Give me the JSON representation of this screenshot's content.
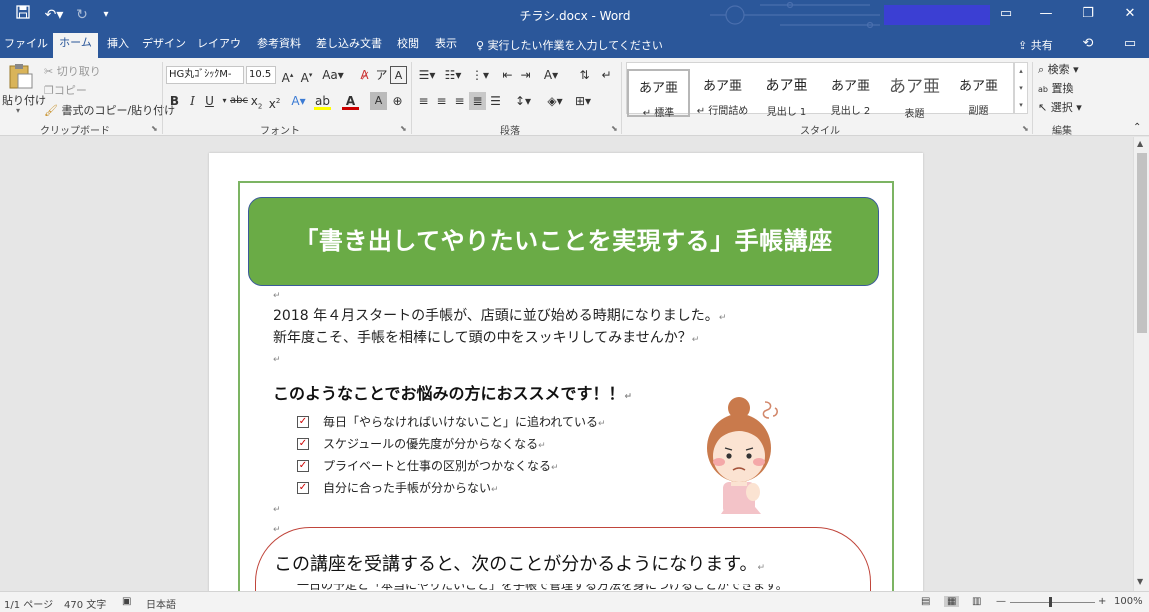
{
  "window": {
    "title": "チラシ.docx  -  Word"
  },
  "quick_access": {
    "save_icon": "save-icon",
    "undo_icon": "undo-icon",
    "redo_icon": "redo-icon",
    "customize_icon": "customize-icon"
  },
  "window_controls": {
    "ribbon_options": "▭",
    "minimize": "—",
    "maximize": "❐",
    "close": "✕"
  },
  "tabs": [
    {
      "label": "ファイル"
    },
    {
      "label": "ホーム"
    },
    {
      "label": "挿入"
    },
    {
      "label": "デザイン"
    },
    {
      "label": "レイアウト"
    },
    {
      "label": "参考資料"
    },
    {
      "label": "差し込み文書"
    },
    {
      "label": "校閲"
    },
    {
      "label": "表示"
    }
  ],
  "active_tab": "ホーム",
  "tell_me": "実行したい作業を入力してください",
  "share_label": "共有",
  "clipboard": {
    "paste": "貼り付け",
    "cut": "切り取り",
    "copy": "コピー",
    "format_painter": "書式のコピー/貼り付け",
    "group_label": "クリップボード"
  },
  "font": {
    "name": "HG丸ｺﾞｼｯｸM-",
    "size": "10.5",
    "group_label": "フォント"
  },
  "paragraph": {
    "group_label": "段落"
  },
  "styles": {
    "group_label": "スタイル",
    "items": [
      {
        "preview": "あア亜",
        "name": "標準"
      },
      {
        "preview": "あア亜",
        "name": "行間詰め"
      },
      {
        "preview": "あア亜",
        "name": "見出し 1"
      },
      {
        "preview": "あア亜",
        "name": "見出し 2"
      },
      {
        "preview": "あア亜",
        "name": "表題"
      },
      {
        "preview": "あア亜",
        "name": "副題"
      }
    ]
  },
  "editing": {
    "find": "検索",
    "replace": "置換",
    "select": "選択",
    "group_label": "編集"
  },
  "document": {
    "banner_title": "「書き出してやりたいことを実現する」手帳講座",
    "intro_line1": "2018 年４月スタートの手帳が、店頭に並び始める時期になりました。",
    "intro_line2": "新年度こそ、手帳を相棒にして頭の中をスッキリしてみませんか？",
    "heading": "このようなことでお悩みの方におススメです！！",
    "checklist": [
      "毎日「やらなければいけないこと」に追われている",
      "スケジュールの優先度が分からなくなる",
      "プライベートと仕事の区別がつかなくなる",
      "自分に合った手帳が分からない"
    ],
    "box_heading": "この講座を受講すると、次のことが分かるようになります。",
    "cut_line": "一日の予定と「本当にやりたいこと」を手帳で管理する方法を身につけることができます。",
    "para_mark": "↵"
  },
  "status": {
    "page": "1/1 ページ",
    "words": "470 文字",
    "language": "日本語",
    "zoom": "100%"
  },
  "accent_colors": {
    "title_bar": "#2b579a",
    "banner_green": "#6aab46",
    "frame_green": "#7cb463",
    "box_red": "#c0453b"
  }
}
